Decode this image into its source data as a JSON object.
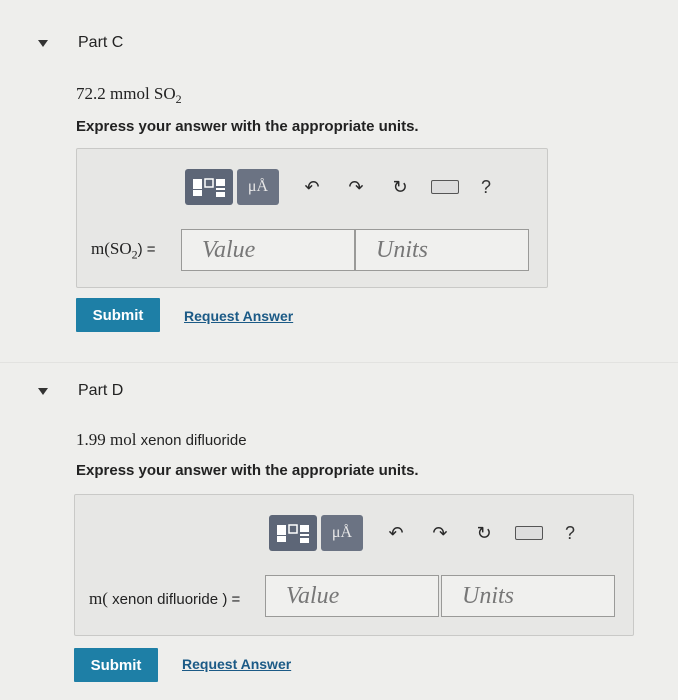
{
  "partC": {
    "title": "Part C",
    "problem_amount": "72.2 mmol SO",
    "problem_sub": "2",
    "prompt": "Express your answer with the appropriate units.",
    "label_prefix": "m(SO",
    "label_sub": "2",
    "label_suffix": ") =",
    "value_placeholder": "Value",
    "units_placeholder": "Units",
    "submit": "Submit",
    "request": "Request Answer"
  },
  "partD": {
    "title": "Part D",
    "problem_amount": "1.99 mol",
    "problem_text": "xenon difluoride",
    "prompt": "Express your answer with the appropriate units.",
    "label_prefix": "m(",
    "label_mid": "xenon difluoride",
    "label_suffix": ") =",
    "value_placeholder": "Value",
    "units_placeholder": "Units",
    "submit": "Submit",
    "request": "Request Answer"
  },
  "toolbar": {
    "mu_label": "μÅ",
    "undo": "↶",
    "redo": "↷",
    "reset": "↻",
    "help": "?"
  }
}
